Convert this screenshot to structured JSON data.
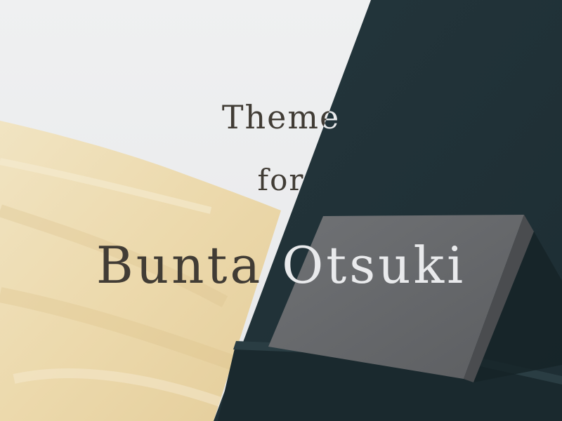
{
  "title": {
    "line1": "Theme",
    "line2": "for",
    "line3": "Bunta Otsuki"
  },
  "colors": {
    "sky": "#ecedef",
    "fabric": "#efdfb6",
    "fabric_shadow": "#e2cc98",
    "dark_wall": "#213339",
    "gray_block": "#65676a",
    "text_dark": "#413c35",
    "text_light": "#e9eaec"
  }
}
